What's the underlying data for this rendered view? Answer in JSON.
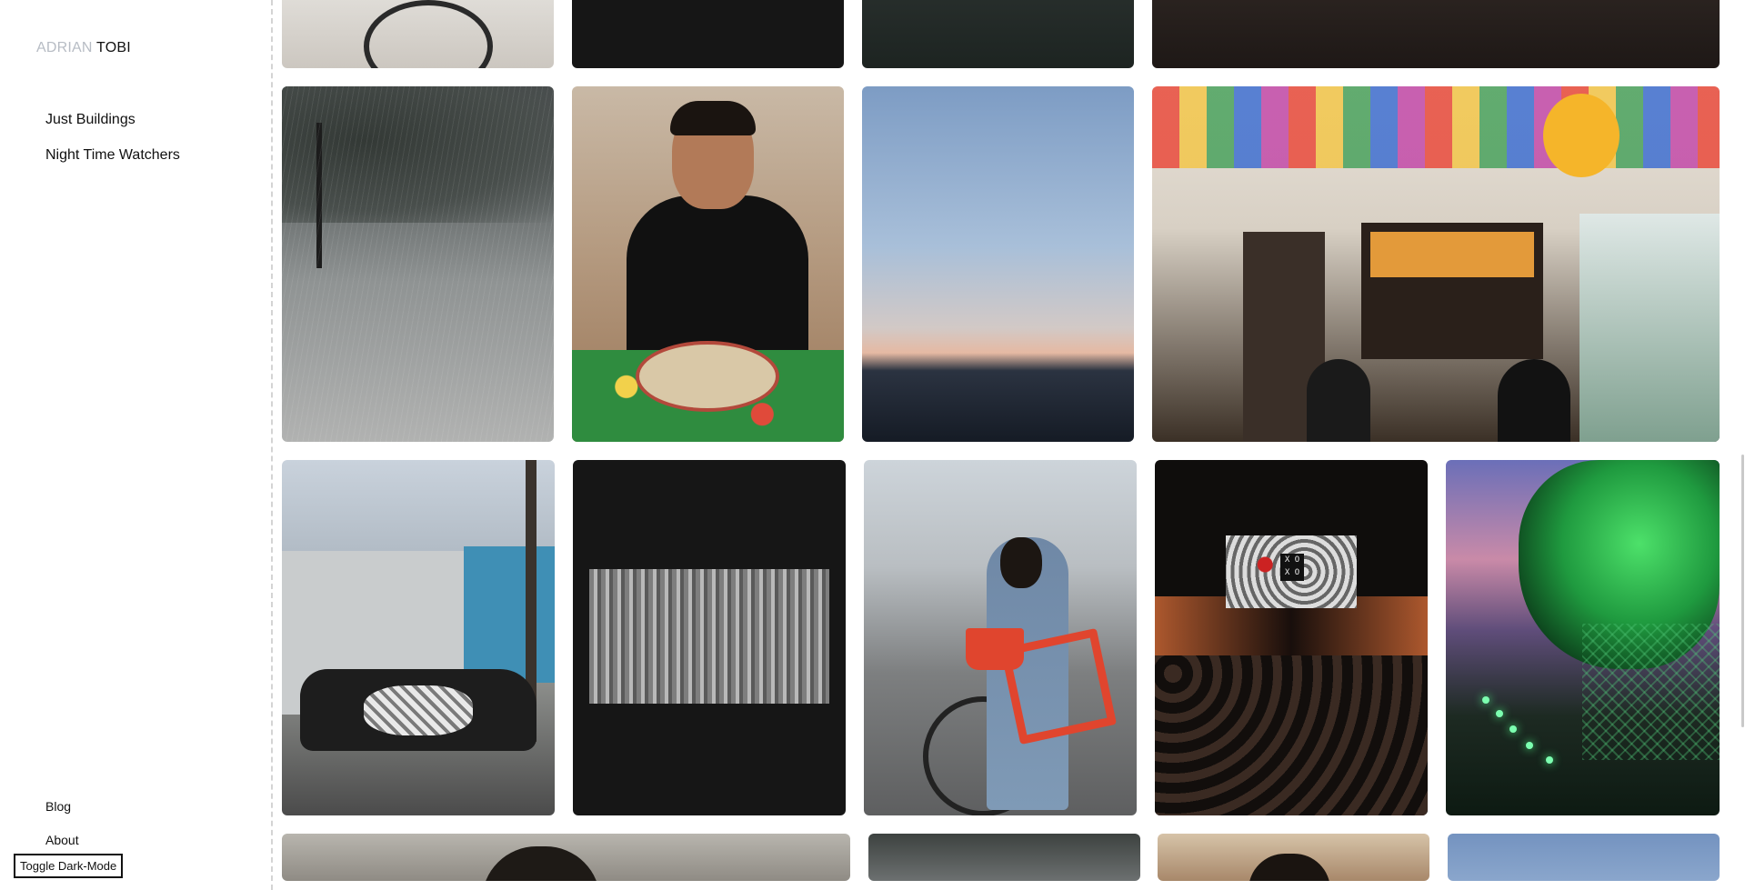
{
  "brand": {
    "first_name": "ADRIAN",
    "last_name": "TOBI"
  },
  "nav": {
    "items": [
      "Just Buildings",
      "Night Time Watchers"
    ]
  },
  "footer": {
    "links": [
      "Blog",
      "About"
    ],
    "toggle_label": "Toggle Dark-Mode"
  },
  "gallery": {
    "xoxo_sign": "X O\nX O"
  },
  "colors": {
    "background": "#ffffff",
    "text": "#111111",
    "brand_muted": "#b7bcc4",
    "divider": "#d4d4d4"
  }
}
